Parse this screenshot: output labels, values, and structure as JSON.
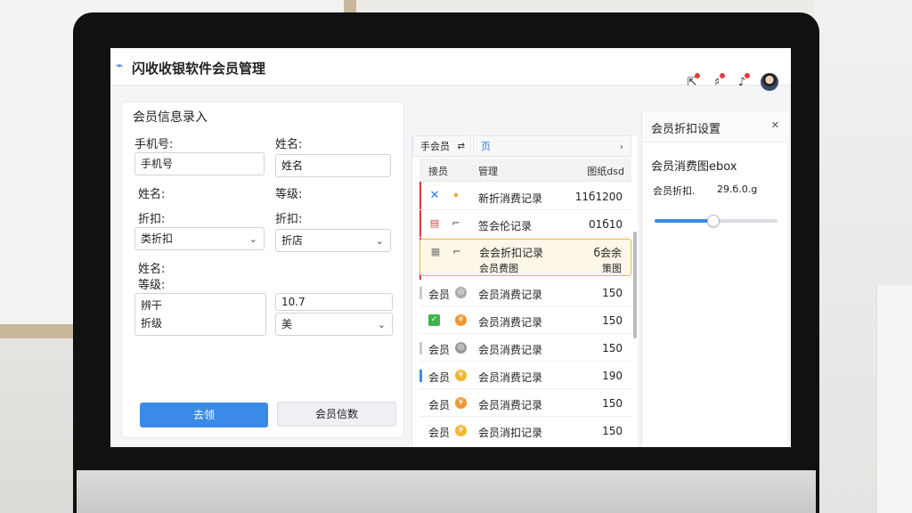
{
  "app": {
    "title": "闪收收银软件会员管理"
  },
  "form": {
    "title": "会员信息录入",
    "phone_label": "手机号:",
    "phone_value": "手机号",
    "name_label_right": "姓名:",
    "name_value_right": "姓名",
    "name_label_2": "姓名:",
    "level_label_right": "等级:",
    "discount_label": "折扣:",
    "discount_select": "类折扣",
    "discount_label_right": "折扣:",
    "discount_select_right": "折店",
    "name_label_3": "姓名:",
    "level_label_3": "等级:",
    "textbox_line1": "辨干",
    "textbox_line2": "折级",
    "right_value": "10.7",
    "right_select": "美",
    "save_button": "去领",
    "secondary_button": "会员信数"
  },
  "records": {
    "tab_left": "手会员",
    "tab_right": "页",
    "header": {
      "col1": "接员",
      "col2": "管理",
      "col3": "图纸dsd"
    },
    "rows": [
      {
        "desc": "新折消费记录",
        "amount": "11б1200"
      },
      {
        "desc": "签会伦记录",
        "amount": "01б10"
      },
      {
        "desc": "会会折扣记录",
        "amount": "б会余",
        "desc2": "会员费图",
        "amount2": "策图"
      },
      {
        "name": "会员",
        "desc": "会员消费记录",
        "amount": "150"
      },
      {
        "desc": "会员消费记录",
        "amount": "150"
      },
      {
        "name": "会员",
        "desc": "会员消费记录",
        "amount": "150"
      },
      {
        "name": "会员",
        "desc": "会员消费记录",
        "amount": "190"
      },
      {
        "name": "会员",
        "desc": "会员消费记录",
        "amount": "150"
      },
      {
        "name": "会员",
        "desc": "会员消扣记录",
        "amount": "150"
      }
    ]
  },
  "settings": {
    "title": "会员折扣设置",
    "subtitle": "会员消费图ebox",
    "label": "会员折扣.",
    "value": "29.б.0.g",
    "slider_level": 0.48
  },
  "colors": {
    "accent": "#3c8ae8",
    "highlight_border": "#e9b648",
    "alert": "#e23b3b"
  }
}
